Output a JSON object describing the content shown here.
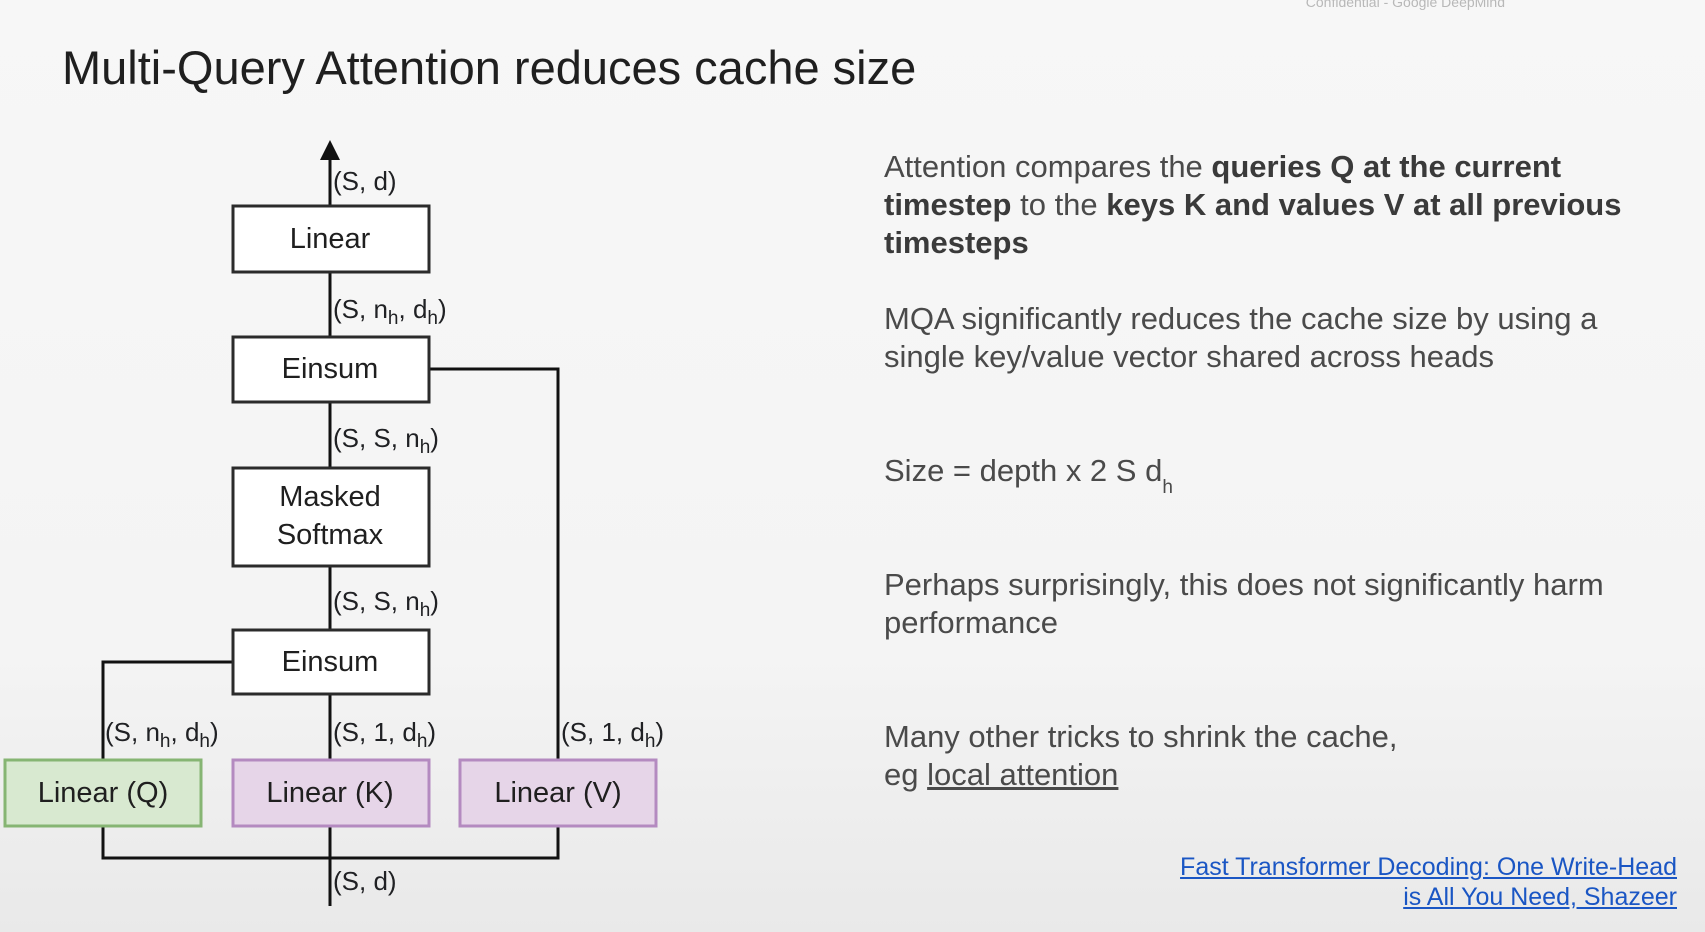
{
  "header": {
    "confidential": "Confidential - Google DeepMind",
    "title": "Multi-Query Attention reduces cache size"
  },
  "diagram": {
    "boxes": {
      "linear": "Linear",
      "einsum_top": "Einsum",
      "masked": "Masked",
      "softmax": "Softmax",
      "einsum_bottom": "Einsum",
      "linear_q": "Linear (Q)",
      "linear_k": "Linear (K)",
      "linear_v": "Linear (V)"
    },
    "labels": {
      "out_shape": "(S, d)",
      "linear_in": {
        "pre": "(S, n",
        "s1": "h",
        "mid": ", d",
        "s2": "h",
        "post": ")"
      },
      "einsum_top_in": {
        "pre": "(S, S, n",
        "s1": "h",
        "post": ")"
      },
      "softmax_in": {
        "pre": "(S, S, n",
        "s1": "h",
        "post": ")"
      },
      "q_out": {
        "pre": "(S, n",
        "s1": "h",
        "mid": ", d",
        "s2": "h",
        "post": ")"
      },
      "k_out": {
        "pre": "(S, 1, d",
        "s1": "h",
        "post": ")"
      },
      "v_out": {
        "pre": "(S, 1, d",
        "s1": "h",
        "post": ")"
      },
      "in_shape": "(S, d)"
    }
  },
  "text": {
    "p1": {
      "a": "Attention compares the ",
      "b1": "queries Q at the current timestep",
      "c": " to the ",
      "b2": "keys K and values V at all previous timesteps"
    },
    "p2": "MQA significantly reduces the cache size by using a single key/value vector shared across heads",
    "p3": {
      "main": "Size = depth x 2 S d",
      "sub": "h"
    },
    "p4": "Perhaps surprisingly, this does not significantly harm performance",
    "p5": {
      "line1": "Many other tricks to shrink the cache,",
      "pre": "eg ",
      "link": "local attention"
    },
    "reference": {
      "line1": "Fast Transformer Decoding: One Write-Head",
      "line2": "is All You Need, Shazeer"
    }
  }
}
